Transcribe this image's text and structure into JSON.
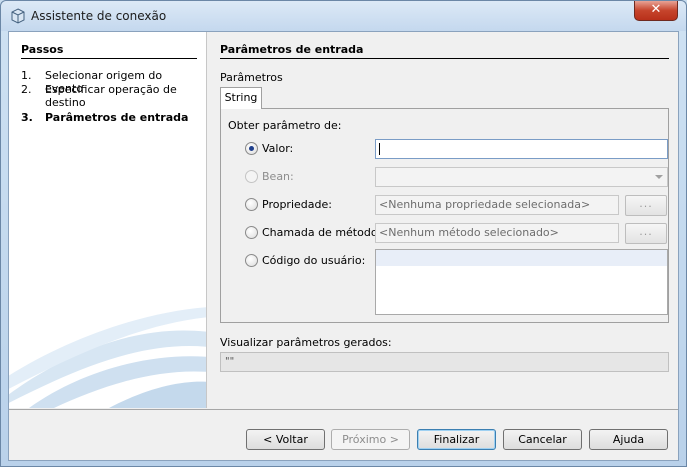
{
  "window": {
    "title": "Assistente de conexão",
    "close_glyph": "✕"
  },
  "steps": {
    "title": "Passos",
    "items": [
      {
        "num": "1.",
        "label": "Selecionar origem do evento"
      },
      {
        "num": "2.",
        "label": "Especificar operação de destino"
      },
      {
        "num": "3.",
        "label": "Parâmetros de entrada"
      }
    ]
  },
  "main": {
    "section_title": "Parâmetros de entrada",
    "params_label": "Parâmetros",
    "tab_label": "String",
    "group_label": "Obter parâmetro de:",
    "options": {
      "valor": "Valor:",
      "bean": "Bean:",
      "propriedade": "Propriedade:",
      "chamada": "Chamada de método:",
      "codigo": "Código do usuário:"
    },
    "propriedade_placeholder": "<Nenhuma propriedade selecionada>",
    "metodo_placeholder": "<Nenhum método selecionado>",
    "ellipsis": "...",
    "preview_label": "Visualizar parâmetros gerados:",
    "preview_value": "\"\""
  },
  "buttons": {
    "back": "< Voltar",
    "next": "Próximo >",
    "finish": "Finalizar",
    "cancel": "Cancelar",
    "help": "Ajuda"
  },
  "colors": {
    "accent": "#3c7fb1",
    "close": "#c6442c"
  }
}
